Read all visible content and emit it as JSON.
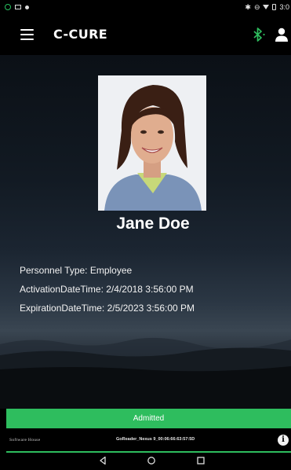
{
  "status_bar": {
    "time": "3:0",
    "icons": [
      "notification-icon",
      "screenshot-icon",
      "dot-icon",
      "bluetooth-icon",
      "do-not-disturb-icon",
      "wifi-icon",
      "battery-icon"
    ]
  },
  "app_bar": {
    "title": "C-CURE",
    "icons": [
      "menu-icon",
      "bluetooth-icon",
      "user-icon"
    ],
    "accent_color": "#2ebd5e"
  },
  "profile": {
    "name": "Jane Doe",
    "personnel_type": "Personnel Type: Employee",
    "activation": "ActivationDateTime: 2/4/2018 3:56:00 PM",
    "expiration": "ExpirationDateTime: 2/5/2023 3:56:00 PM"
  },
  "status": {
    "label": "Admitted",
    "color": "#2ebd5e"
  },
  "footer": {
    "brand": "Software House",
    "reader": "GoReader_Nexus 9_00:06:66:63:57:5D",
    "icons": [
      "info-icon"
    ]
  },
  "nav_bar": {
    "icons": [
      "back-icon",
      "home-icon",
      "recent-apps-icon"
    ]
  }
}
